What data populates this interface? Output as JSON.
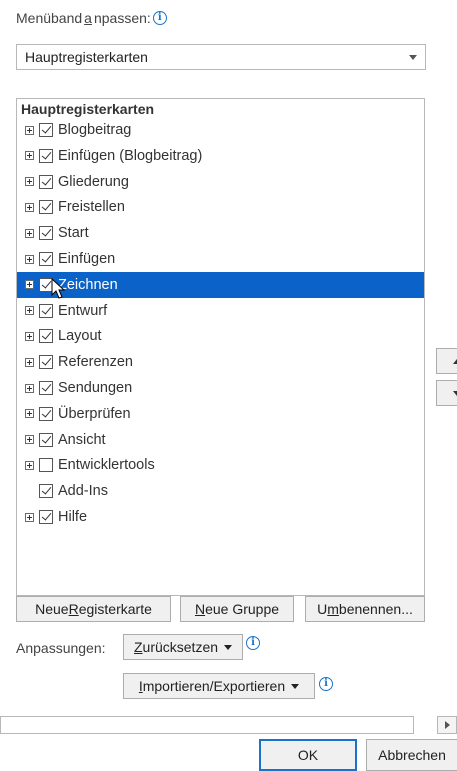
{
  "ribbon_label": {
    "prefix": "Menüband ",
    "underlined": "a",
    "suffix": "npassen:"
  },
  "ribbon_dropdown": {
    "value": "Hauptregisterkarten"
  },
  "tree": {
    "header": "Hauptregisterkarten",
    "items": [
      {
        "label": "Blogbeitrag",
        "checked": true,
        "expander": true
      },
      {
        "label": "Einfügen (Blogbeitrag)",
        "checked": true,
        "expander": true
      },
      {
        "label": "Gliederung",
        "checked": true,
        "expander": true
      },
      {
        "label": "Freistellen",
        "checked": true,
        "expander": true
      },
      {
        "label": "Start",
        "checked": true,
        "expander": true
      },
      {
        "label": "Einfügen",
        "checked": true,
        "expander": true
      },
      {
        "label": "Zeichnen",
        "checked": true,
        "expander": true,
        "selected": true
      },
      {
        "label": "Entwurf",
        "checked": true,
        "expander": true
      },
      {
        "label": "Layout",
        "checked": true,
        "expander": true
      },
      {
        "label": "Referenzen",
        "checked": true,
        "expander": true
      },
      {
        "label": "Sendungen",
        "checked": true,
        "expander": true
      },
      {
        "label": "Überprüfen",
        "checked": true,
        "expander": true
      },
      {
        "label": "Ansicht",
        "checked": true,
        "expander": true
      },
      {
        "label": "Entwicklertools",
        "checked": false,
        "expander": true
      },
      {
        "label": "Add-Ins",
        "checked": true,
        "expander": false
      },
      {
        "label": "Hilfe",
        "checked": true,
        "expander": true
      }
    ]
  },
  "buttons": {
    "new_tab": {
      "prefix": "Neue ",
      "underlined": "R",
      "suffix": "egisterkarte"
    },
    "new_group": {
      "prefix": "",
      "underlined": "N",
      "suffix": "eue Gruppe"
    },
    "rename": {
      "prefix": "U",
      "underlined": "m",
      "suffix": "benennen..."
    },
    "reset": {
      "prefix": "",
      "underlined": "Z",
      "suffix": "urücksetzen"
    },
    "import_export": {
      "prefix": "",
      "underlined": "I",
      "suffix": "mportieren/Exportieren"
    },
    "ok": "OK",
    "cancel": "Abbrechen"
  },
  "customizations_label": "Anpassungen:",
  "info_glyph": "i",
  "colors": {
    "selection": "#0b63c9",
    "info": "#1a73c9"
  }
}
